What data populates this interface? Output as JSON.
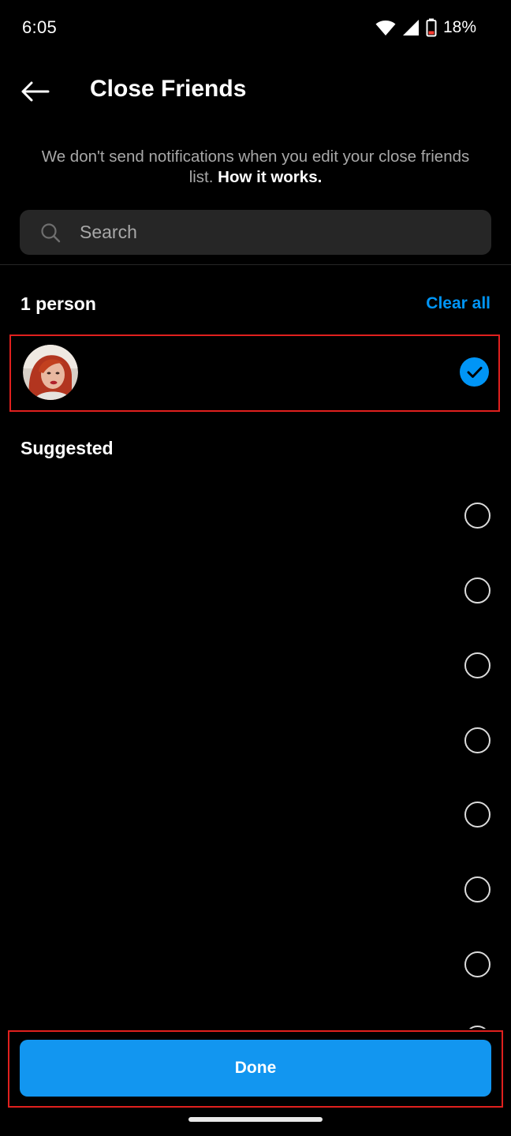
{
  "status_bar": {
    "time": "6:05",
    "battery_percent": "18%",
    "icons": [
      "wifi-icon",
      "cell-signal-icon",
      "battery-low-icon"
    ]
  },
  "header": {
    "title": "Close Friends",
    "back_icon": "back-arrow-icon"
  },
  "info": {
    "text": "We don't send notifications when you edit your close friends list.",
    "link": "How it works."
  },
  "search": {
    "placeholder": "Search",
    "value": ""
  },
  "selected_section": {
    "count_label": "1 person",
    "clear_all_label": "Clear all",
    "items": [
      {
        "selected": true
      }
    ]
  },
  "suggested_section": {
    "title": "Suggested",
    "items": [
      {
        "selected": false
      },
      {
        "selected": false
      },
      {
        "selected": false
      },
      {
        "selected": false
      },
      {
        "selected": false
      },
      {
        "selected": false
      },
      {
        "selected": false
      },
      {
        "selected": false
      }
    ]
  },
  "footer": {
    "done_label": "Done"
  },
  "colors": {
    "accent": "#0095f6",
    "done_button": "#1296f0",
    "highlight_frame": "#e0201e"
  }
}
